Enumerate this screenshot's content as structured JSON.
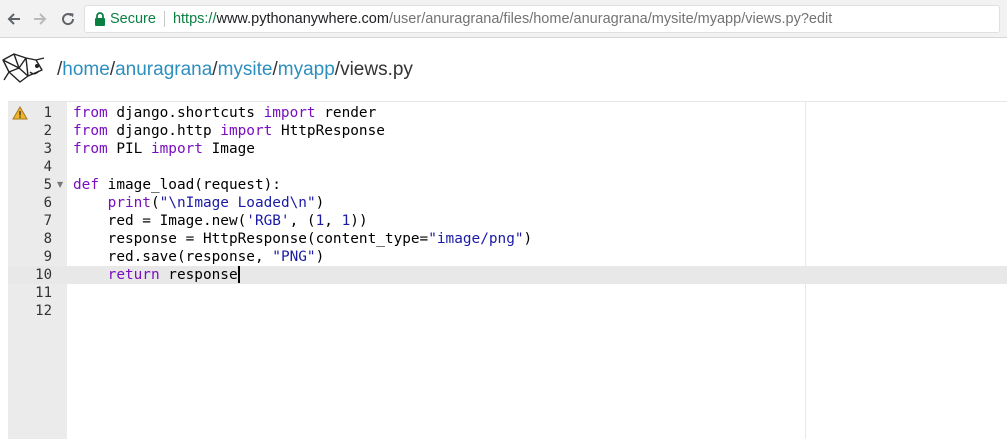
{
  "browser": {
    "secure_label": "Secure",
    "url_protocol": "https://",
    "url_host": "www.pythonanywhere.com",
    "url_path": "/user/anuragrana/files/home/anuragrana/mysite/myapp/views.py?edit"
  },
  "breadcrumb": {
    "parts": [
      "home",
      "anuragrana",
      "mysite",
      "myapp"
    ],
    "file": "views.py"
  },
  "editor": {
    "active_line": 10,
    "lines": [
      {
        "num": "1",
        "tokens": [
          {
            "t": "from",
            "c": "kw"
          },
          {
            "t": " django.shortcuts ",
            "c": "plain"
          },
          {
            "t": "import",
            "c": "kw"
          },
          {
            "t": " render",
            "c": "plain"
          }
        ]
      },
      {
        "num": "2",
        "tokens": [
          {
            "t": "from",
            "c": "kw"
          },
          {
            "t": " django.http ",
            "c": "plain"
          },
          {
            "t": "import",
            "c": "kw"
          },
          {
            "t": " HttpResponse",
            "c": "plain"
          }
        ]
      },
      {
        "num": "3",
        "tokens": [
          {
            "t": "from",
            "c": "kw"
          },
          {
            "t": " PIL ",
            "c": "plain"
          },
          {
            "t": "import",
            "c": "kw"
          },
          {
            "t": " Image",
            "c": "plain"
          }
        ]
      },
      {
        "num": "4",
        "tokens": []
      },
      {
        "num": "5",
        "tokens": [
          {
            "t": "def",
            "c": "kw"
          },
          {
            "t": " image_load(request):",
            "c": "plain"
          }
        ]
      },
      {
        "num": "6",
        "tokens": [
          {
            "t": "    ",
            "c": "plain"
          },
          {
            "t": "print",
            "c": "kw"
          },
          {
            "t": "(",
            "c": "plain"
          },
          {
            "t": "\"",
            "c": "str"
          },
          {
            "t": "\\n",
            "c": "esc"
          },
          {
            "t": "Image Loaded",
            "c": "str"
          },
          {
            "t": "\\n",
            "c": "esc"
          },
          {
            "t": "\"",
            "c": "str"
          },
          {
            "t": ")",
            "c": "plain"
          }
        ]
      },
      {
        "num": "7",
        "tokens": [
          {
            "t": "    red = Image.new(",
            "c": "plain"
          },
          {
            "t": "'RGB'",
            "c": "str"
          },
          {
            "t": ", (",
            "c": "plain"
          },
          {
            "t": "1",
            "c": "num"
          },
          {
            "t": ", ",
            "c": "plain"
          },
          {
            "t": "1",
            "c": "num"
          },
          {
            "t": "))",
            "c": "plain"
          }
        ]
      },
      {
        "num": "8",
        "tokens": [
          {
            "t": "    response = HttpResponse(content_type=",
            "c": "plain"
          },
          {
            "t": "\"image/png\"",
            "c": "str"
          },
          {
            "t": ")",
            "c": "plain"
          }
        ]
      },
      {
        "num": "9",
        "tokens": [
          {
            "t": "    red.save(response, ",
            "c": "plain"
          },
          {
            "t": "\"PNG\"",
            "c": "str"
          },
          {
            "t": ")",
            "c": "plain"
          }
        ]
      },
      {
        "num": "10",
        "tokens": [
          {
            "t": "    ",
            "c": "plain"
          },
          {
            "t": "return",
            "c": "kw"
          },
          {
            "t": " response",
            "c": "plain"
          }
        ]
      },
      {
        "num": "11",
        "tokens": []
      },
      {
        "num": "12",
        "tokens": []
      }
    ]
  },
  "colors": {
    "keyword": "#7a0fbf",
    "string": "#1a1aa6",
    "link": "#2d8fbf",
    "secure": "#0b8043"
  },
  "icons": {
    "warning_line": 1,
    "fold_line": 5
  }
}
